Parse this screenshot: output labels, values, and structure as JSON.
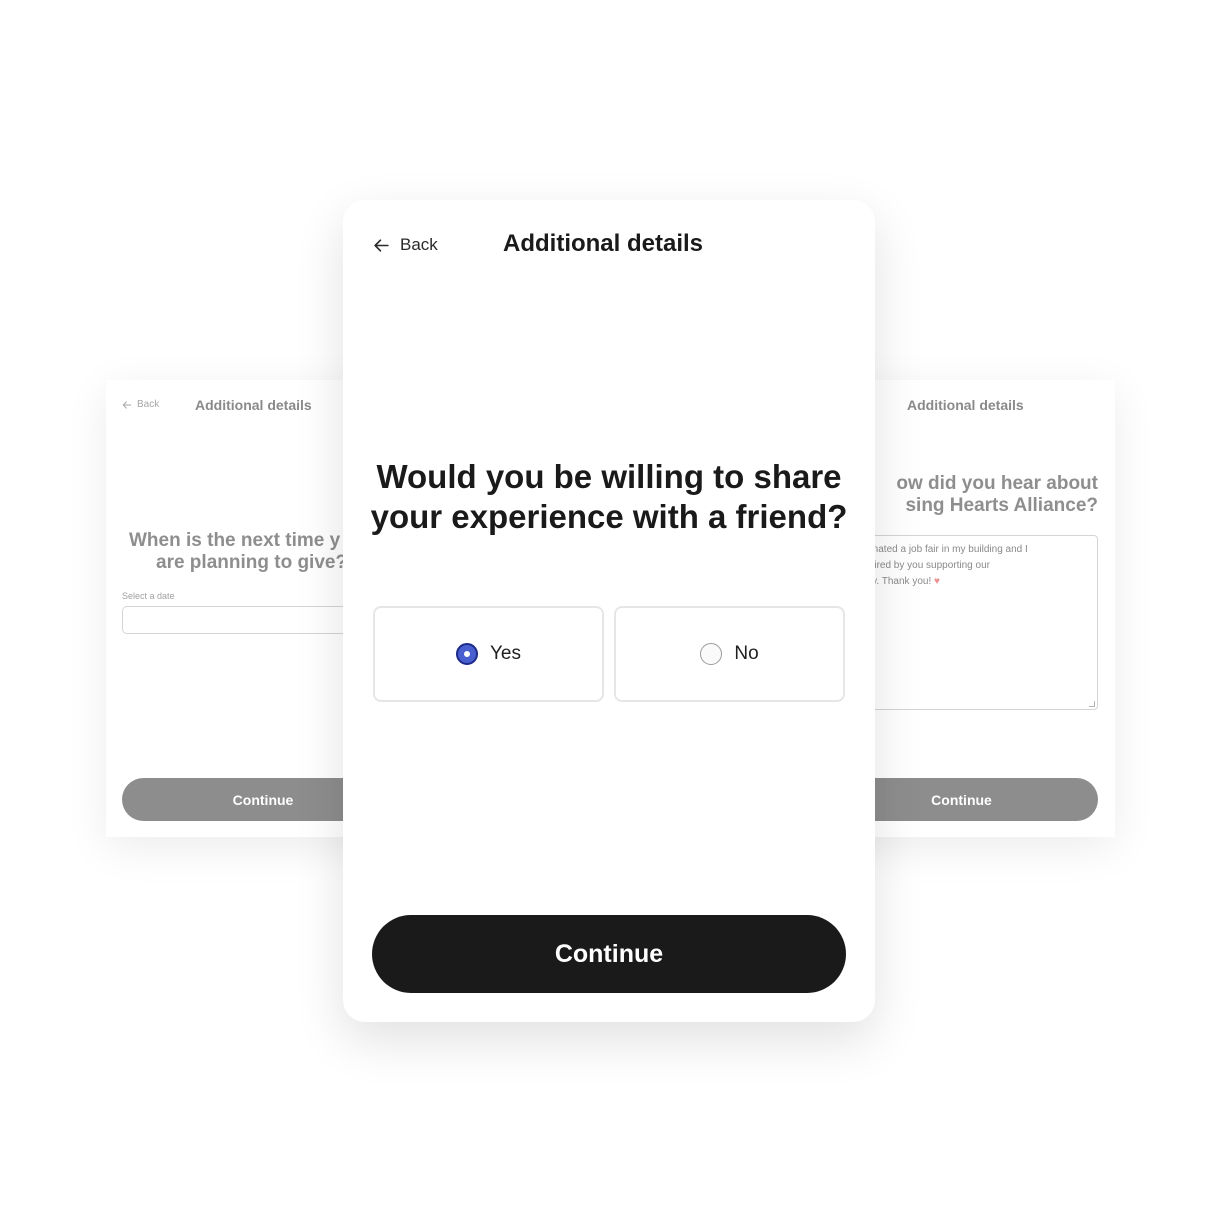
{
  "left_card": {
    "back_label": "Back",
    "header_title": "Additional details",
    "question_line1": "When is the next time y",
    "question_line2": "are planning to give?",
    "date_label": "Select a date",
    "date_value": "",
    "continue_label": "Continue"
  },
  "right_card": {
    "header_title": "Additional details",
    "question_line1": "ow did you hear about",
    "question_line2": "sing Hearts Alliance?",
    "textarea_line1": "ordinated a job fair in my building and I",
    "textarea_line2": "inspired by you supporting our",
    "textarea_line3": "unity. Thank you! ",
    "heart": "♥",
    "continue_label": "Continue"
  },
  "main_card": {
    "back_label": "Back",
    "header_title": "Additional details",
    "question": "Would you be willing to share your experience with a friend?",
    "options": [
      {
        "label": "Yes",
        "selected": true
      },
      {
        "label": "No",
        "selected": false
      }
    ],
    "continue_label": "Continue"
  },
  "colors": {
    "primary_button": "#1a1a1a",
    "radio_selected": "#4a5fcf",
    "muted_button": "#8d8d8d"
  }
}
